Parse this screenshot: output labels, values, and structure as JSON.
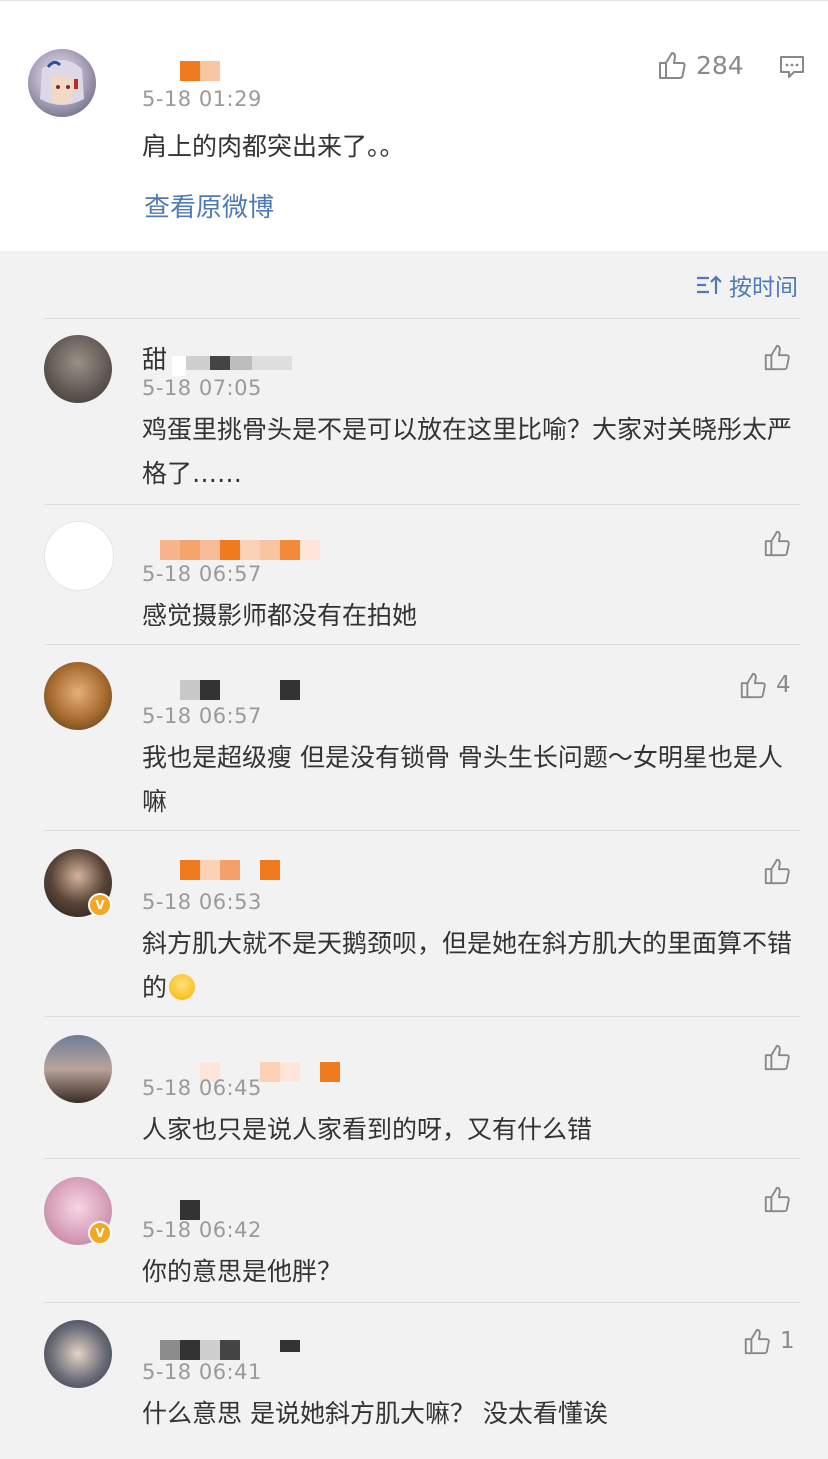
{
  "top_comment": {
    "time": "5-18 01:29",
    "text": "肩上的肉都突出来了。。",
    "likes": "284",
    "view_original": "查看原微博"
  },
  "sort": {
    "label": "按时间"
  },
  "comments": [
    {
      "name_visible": "甜",
      "time": "5-18 07:05",
      "text": "鸡蛋里挑骨头是不是可以放在这里比喻？大家对关晓彤太严格了……",
      "likes": ""
    },
    {
      "name_visible": "",
      "time": "5-18 06:57",
      "text": "感觉摄影师都没有在拍她",
      "likes": ""
    },
    {
      "name_visible": "",
      "time": "5-18 06:57",
      "text": "我也是超级瘦 但是没有锁骨 骨头生长问题～女明星也是人嘛",
      "likes": "4"
    },
    {
      "name_visible": "",
      "time": "5-18 06:53",
      "text": "斜方肌大就不是天鹅颈呗，但是她在斜方肌大的里面算不错的",
      "likes": ""
    },
    {
      "name_visible": "",
      "time": "5-18 06:45",
      "text": "人家也只是说人家看到的呀，又有什么错",
      "likes": ""
    },
    {
      "name_visible": "",
      "time": "5-18 06:42",
      "text": "你的意思是他胖？",
      "likes": ""
    },
    {
      "name_visible": "",
      "time": "5-18 06:41",
      "text": "什么意思 是说她斜方肌大嘛？ 没太看懂诶",
      "likes": "1"
    }
  ],
  "colors": {
    "accent": "#4f7ab5",
    "mosaic_orange": "#f07a1e",
    "verified": "#f5a623"
  }
}
